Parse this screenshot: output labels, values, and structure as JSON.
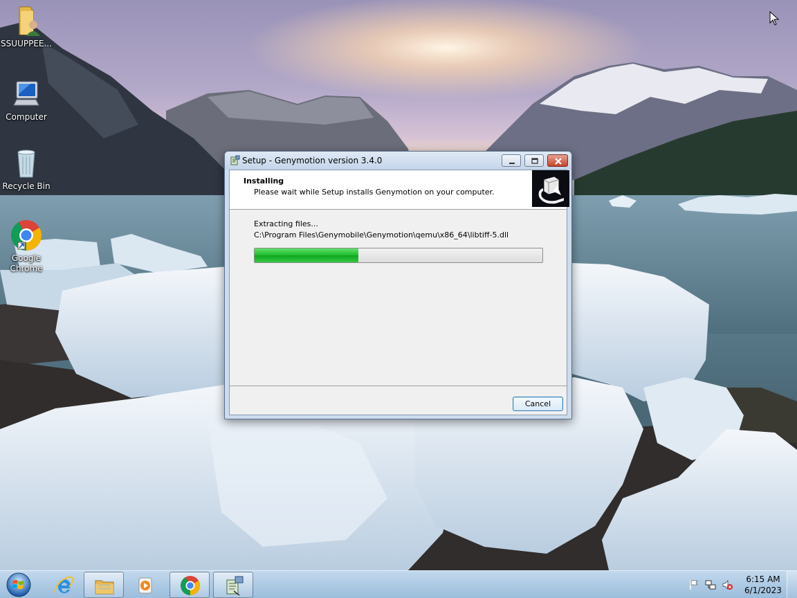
{
  "desktop": {
    "icons": [
      {
        "label": "SSUUPPEE...",
        "icon": "user-folder-icon"
      },
      {
        "label": "Computer",
        "icon": "computer-icon"
      },
      {
        "label": "Recycle Bin",
        "icon": "recycle-bin-icon"
      },
      {
        "label": "Google Chrome",
        "icon": "chrome-icon"
      }
    ]
  },
  "window": {
    "title": "Setup - Genymotion version 3.4.0",
    "header_title": "Installing",
    "header_subtitle": "Please wait while Setup installs Genymotion on your computer.",
    "status": "Extracting files...",
    "file_path": "C:\\Program Files\\Genymobile\\Genymotion\\qemu\\x86_64\\libtiff-5.dll",
    "progress_percent": 36,
    "cancel_label": "Cancel"
  },
  "taskbar": {
    "buttons": [
      {
        "icon": "internet-explorer-icon",
        "state": "pinned"
      },
      {
        "icon": "windows-explorer-icon",
        "state": "pinned"
      },
      {
        "icon": "media-player-icon",
        "state": "pinned"
      },
      {
        "icon": "chrome-icon",
        "state": "running"
      },
      {
        "icon": "setup-icon",
        "state": "active"
      }
    ],
    "tray_icons": [
      "action-center-flag-icon",
      "network-icon",
      "volume-muted-icon"
    ],
    "time": "6:15 AM",
    "date": "6/1/2023"
  },
  "colors": {
    "progress_green": "#1dbb2c",
    "close_red": "#c7432b",
    "taskbar_blue": "#a6c4e2"
  }
}
